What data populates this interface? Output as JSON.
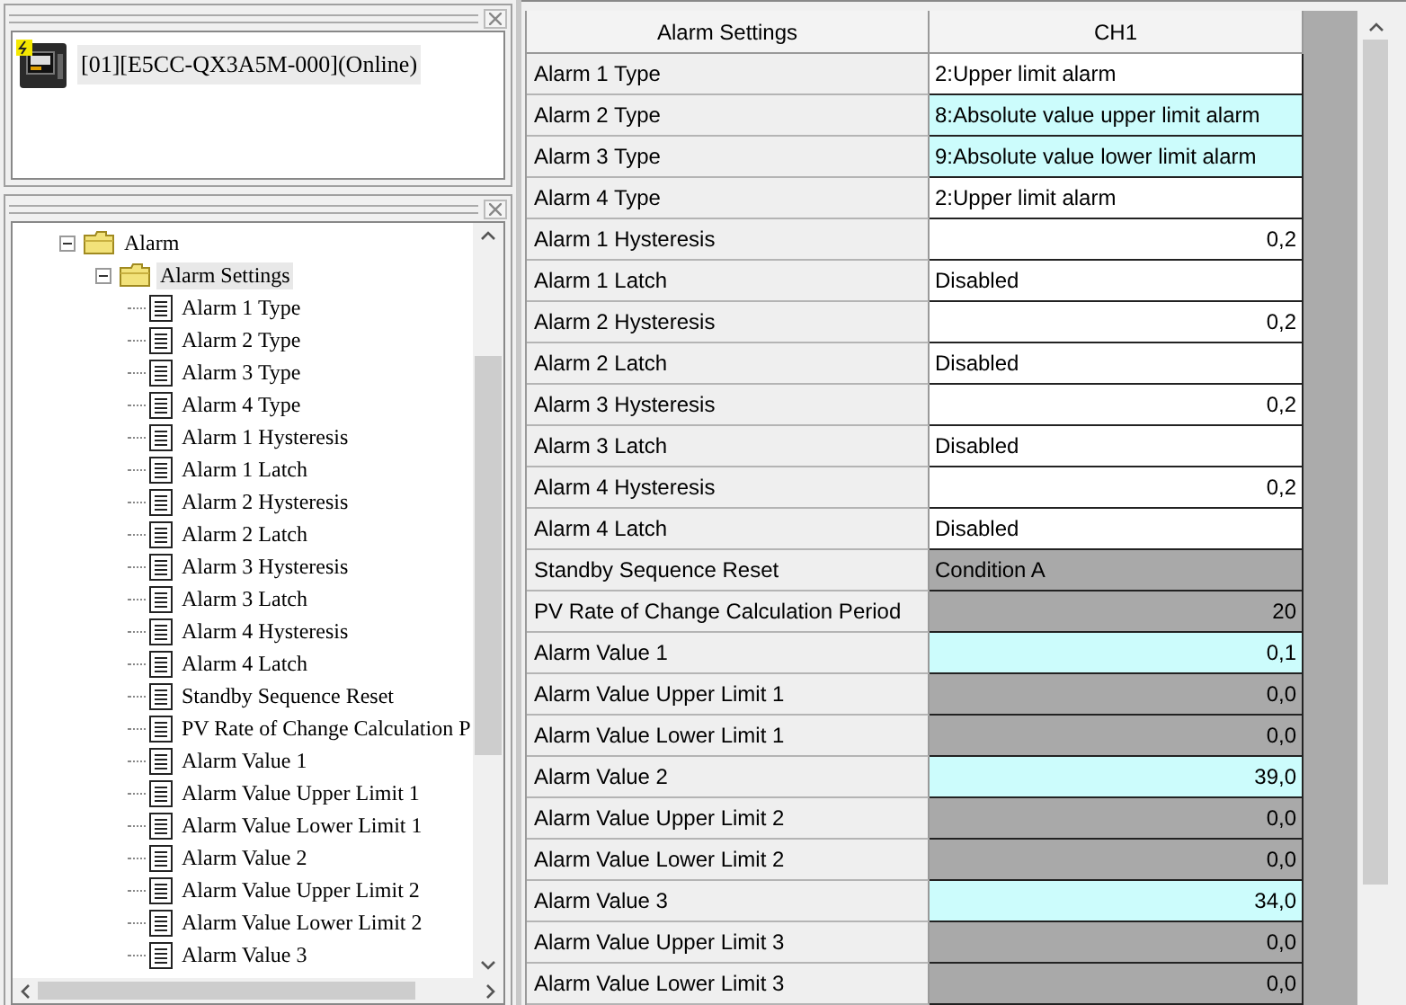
{
  "device_pane": {
    "device": "[01][E5CC-QX3A5M-000](Online)"
  },
  "tree": {
    "items": [
      {
        "label": "Alarm",
        "expanded": true,
        "children": [
          {
            "label": "Alarm Settings",
            "expanded": true,
            "selected": true,
            "children": [
              {
                "label": "Alarm 1 Type"
              },
              {
                "label": "Alarm 2 Type"
              },
              {
                "label": "Alarm 3 Type"
              },
              {
                "label": "Alarm 4 Type"
              },
              {
                "label": "Alarm 1 Hysteresis"
              },
              {
                "label": "Alarm 1 Latch"
              },
              {
                "label": "Alarm 2 Hysteresis"
              },
              {
                "label": "Alarm 2 Latch"
              },
              {
                "label": "Alarm 3 Hysteresis"
              },
              {
                "label": "Alarm 3 Latch"
              },
              {
                "label": "Alarm 4 Hysteresis"
              },
              {
                "label": "Alarm 4 Latch"
              },
              {
                "label": "Standby Sequence Reset"
              },
              {
                "label": "PV Rate of Change Calculation P"
              },
              {
                "label": "Alarm Value 1"
              },
              {
                "label": "Alarm Value Upper Limit 1"
              },
              {
                "label": "Alarm Value Lower Limit 1"
              },
              {
                "label": "Alarm Value 2"
              },
              {
                "label": "Alarm Value Upper Limit 2"
              },
              {
                "label": "Alarm Value Lower Limit 2"
              },
              {
                "label": "Alarm Value 3"
              }
            ]
          }
        ]
      }
    ]
  },
  "table": {
    "columns": [
      "Alarm Settings",
      "CH1"
    ],
    "rows": [
      {
        "name": "Alarm 1 Type",
        "value": "2:Upper limit alarm",
        "kind": "normal",
        "numeric": false
      },
      {
        "name": "Alarm 2 Type",
        "value": "8:Absolute value upper limit alarm",
        "kind": "changed",
        "numeric": false
      },
      {
        "name": "Alarm 3 Type",
        "value": "9:Absolute value lower limit alarm",
        "kind": "changed",
        "numeric": false
      },
      {
        "name": "Alarm 4 Type",
        "value": "2:Upper limit alarm",
        "kind": "normal",
        "numeric": false
      },
      {
        "name": "Alarm 1 Hysteresis",
        "value": "0,2",
        "kind": "normal",
        "numeric": true
      },
      {
        "name": "Alarm 1 Latch",
        "value": "Disabled",
        "kind": "normal",
        "numeric": false
      },
      {
        "name": "Alarm 2 Hysteresis",
        "value": "0,2",
        "kind": "normal",
        "numeric": true
      },
      {
        "name": "Alarm 2 Latch",
        "value": "Disabled",
        "kind": "normal",
        "numeric": false
      },
      {
        "name": "Alarm 3 Hysteresis",
        "value": "0,2",
        "kind": "normal",
        "numeric": true
      },
      {
        "name": "Alarm 3 Latch",
        "value": "Disabled",
        "kind": "normal",
        "numeric": false
      },
      {
        "name": "Alarm 4 Hysteresis",
        "value": "0,2",
        "kind": "normal",
        "numeric": true
      },
      {
        "name": "Alarm 4 Latch",
        "value": "Disabled",
        "kind": "normal",
        "numeric": false
      },
      {
        "name": "Standby Sequence Reset",
        "value": "Condition A",
        "kind": "disabled",
        "numeric": false
      },
      {
        "name": "PV Rate of Change Calculation Period",
        "value": "20",
        "kind": "disabled",
        "numeric": true
      },
      {
        "name": "Alarm Value 1",
        "value": "0,1",
        "kind": "changed",
        "numeric": true
      },
      {
        "name": "Alarm Value Upper Limit 1",
        "value": "0,0",
        "kind": "disabled",
        "numeric": true
      },
      {
        "name": "Alarm Value Lower Limit 1",
        "value": "0,0",
        "kind": "disabled",
        "numeric": true
      },
      {
        "name": "Alarm Value 2",
        "value": "39,0",
        "kind": "changed",
        "numeric": true
      },
      {
        "name": "Alarm Value Upper Limit 2",
        "value": "0,0",
        "kind": "disabled",
        "numeric": true
      },
      {
        "name": "Alarm Value Lower Limit 2",
        "value": "0,0",
        "kind": "disabled",
        "numeric": true
      },
      {
        "name": "Alarm Value 3",
        "value": "34,0",
        "kind": "changed",
        "numeric": true
      },
      {
        "name": "Alarm Value Upper Limit 3",
        "value": "0,0",
        "kind": "disabled",
        "numeric": true
      },
      {
        "name": "Alarm Value Lower Limit 3",
        "value": "0,0",
        "kind": "disabled",
        "numeric": true
      }
    ]
  }
}
